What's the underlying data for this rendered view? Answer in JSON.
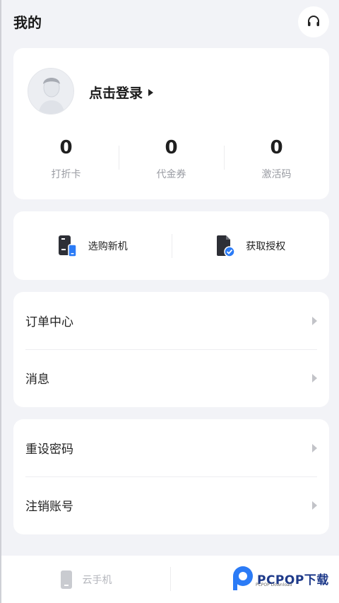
{
  "header": {
    "title": "我的"
  },
  "profile": {
    "login_label": "点击登录",
    "stats": [
      {
        "value": "0",
        "label": "打折卡"
      },
      {
        "value": "0",
        "label": "代金券"
      },
      {
        "value": "0",
        "label": "激活码"
      }
    ]
  },
  "actions": [
    {
      "label": "选购新机",
      "icon": "phone-shop-icon"
    },
    {
      "label": "获取授权",
      "icon": "document-check-icon"
    }
  ],
  "menu1": [
    {
      "label": "订单中心"
    },
    {
      "label": "消息"
    }
  ],
  "menu2": [
    {
      "label": "重设密码"
    },
    {
      "label": "注销账号"
    }
  ],
  "tabbar": [
    {
      "label": "云手机",
      "icon": "phone-icon"
    }
  ],
  "watermark": {
    "text": "PCPOP下载",
    "sub": "PCPOP Download"
  },
  "colors": {
    "accent": "#2b7bf6",
    "background": "#f2f3f7"
  }
}
